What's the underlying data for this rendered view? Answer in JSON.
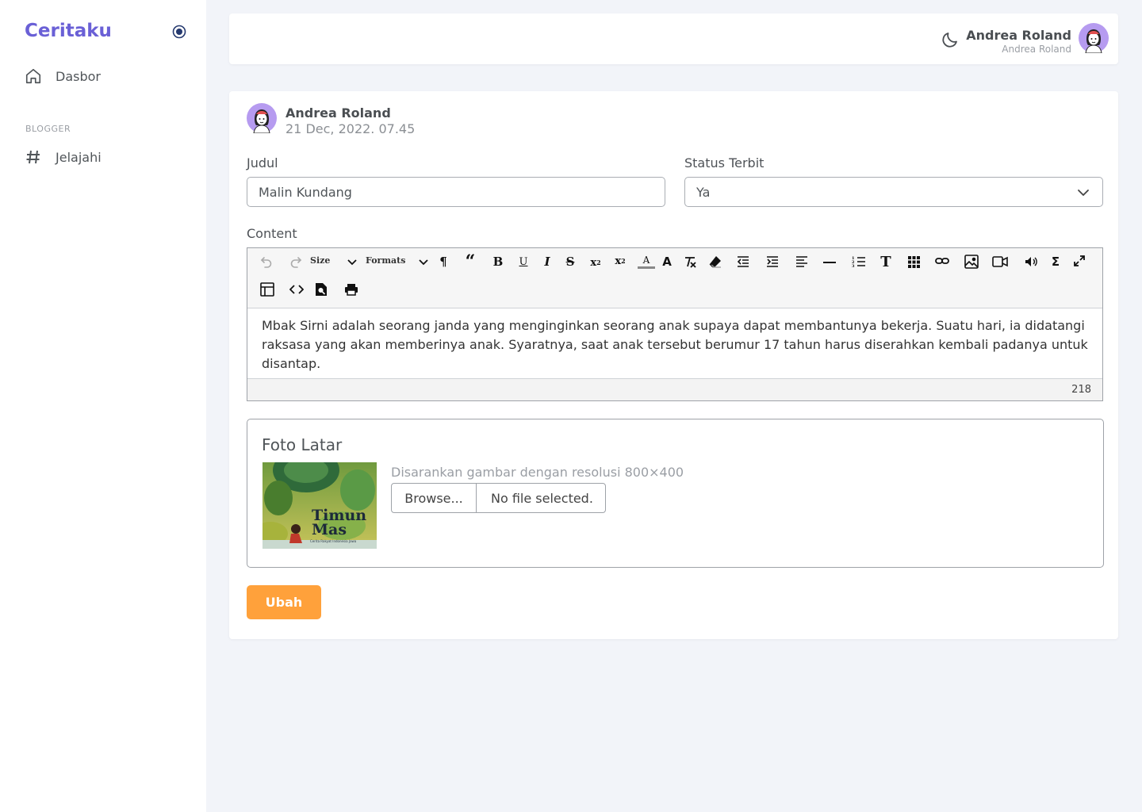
{
  "sidebar": {
    "brand": "Ceritaku",
    "items": [
      {
        "label": "Dasbor",
        "icon": "home-icon"
      },
      {
        "label": "Jelajahi",
        "icon": "hash-icon"
      }
    ],
    "section_title": "BLOGGER"
  },
  "header": {
    "user_name": "Andrea Roland",
    "user_role": "Andrea Roland"
  },
  "post": {
    "author": "Andrea Roland",
    "date": "21 Dec, 2022. 07.45"
  },
  "form": {
    "title_label": "Judul",
    "title_value": "Malin Kundang",
    "status_label": "Status Terbit",
    "status_value": "Ya",
    "content_label": "Content",
    "toolbar": {
      "size_label": "Size",
      "formats_label": "Formats"
    },
    "content_text": "Mbak Sirni adalah seorang janda yang menginginkan seorang anak supaya dapat membantunya bekerja. Suatu hari, ia didatangi raksasa yang akan memberinya anak. Syaratnya, saat anak tersebut berumur 17 tahun harus diserahkan kembali padanya untuk disantap.",
    "char_count": "218",
    "photo_title": "Foto Latar",
    "thumb_title": "Timun Mas",
    "thumb_subtitle": "Cerita Rakyat Indonesia Jawa",
    "photo_hint": "Disarankan gambar dengan resolusi 800×400",
    "browse_label": "Browse...",
    "file_status": "No file selected.",
    "submit_label": "Ubah"
  },
  "colors": {
    "brand": "#6a60d6",
    "accent": "#ffa13b",
    "background": "#f2f4f9"
  }
}
